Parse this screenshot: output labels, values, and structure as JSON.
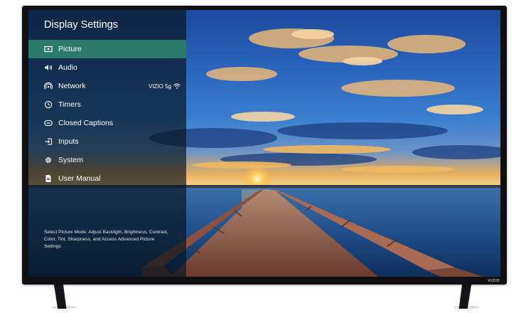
{
  "menu": {
    "title": "Display Settings",
    "items": [
      {
        "label": "Picture",
        "icon": "picture-icon",
        "selected": true,
        "value": ""
      },
      {
        "label": "Audio",
        "icon": "speaker-icon",
        "selected": false,
        "value": ""
      },
      {
        "label": "Network",
        "icon": "network-icon",
        "selected": false,
        "value": "VIZIO 5g"
      },
      {
        "label": "Timers",
        "icon": "clock-icon",
        "selected": false,
        "value": ""
      },
      {
        "label": "Closed Captions",
        "icon": "closed-captions-icon",
        "selected": false,
        "value": ""
      },
      {
        "label": "Inputs",
        "icon": "input-icon",
        "selected": false,
        "value": ""
      },
      {
        "label": "System",
        "icon": "gear-icon",
        "selected": false,
        "value": ""
      },
      {
        "label": "User Manual",
        "icon": "document-icon",
        "selected": false,
        "value": ""
      }
    ],
    "help_text": "Select Picture Mode, Adjust Backlight, Brightness, Contrast, Color, Tint, Sharpness, and Access Advanced Picture Settings"
  },
  "tv": {
    "brand": "VIZIO"
  },
  "colors": {
    "selected": "#2b7a6a",
    "bezel": "#101012"
  }
}
